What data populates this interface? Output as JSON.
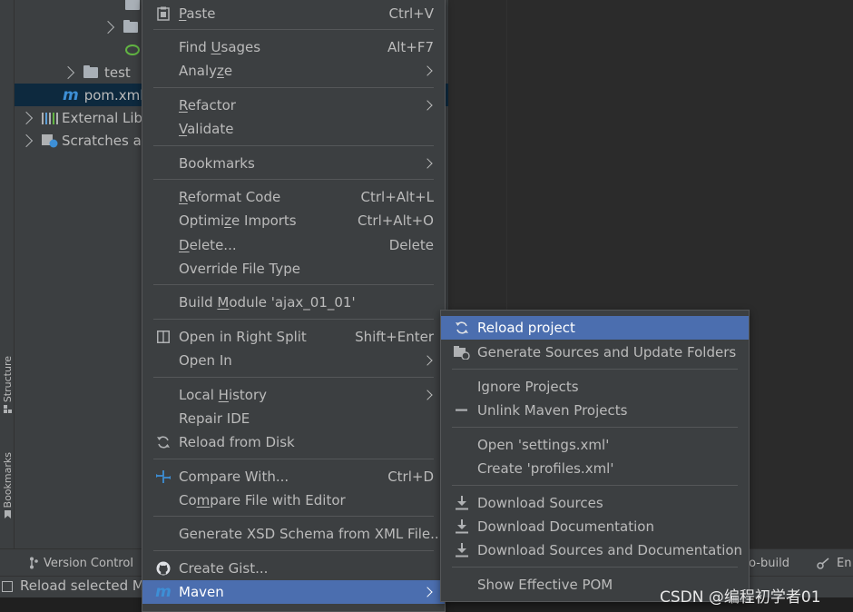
{
  "side_tabs": {
    "structure": "Structure",
    "bookmarks": "Bookmarks"
  },
  "project_tree": {
    "test_label": "test",
    "pom_label": "pom.xml",
    "external_libs_label": "External Lib",
    "scratches_label": "Scratches ar"
  },
  "bottom_tabs": {
    "version_control": "Version Control",
    "auto_build": "to-build",
    "endpoints": "En"
  },
  "status_bar": {
    "text": "Reload selected M"
  },
  "watermark": "CSDN @编程初学者01",
  "context_menu": {
    "paste": {
      "pre": "",
      "u": "P",
      "post": "aste",
      "shortcut": "Ctrl+V"
    },
    "find_usages": {
      "pre": "Find ",
      "u": "U",
      "post": "sages",
      "shortcut": "Alt+F7"
    },
    "analyze": {
      "pre": "Analy",
      "u": "z",
      "post": "e"
    },
    "refactor": {
      "pre": "",
      "u": "R",
      "post": "efactor"
    },
    "validate": {
      "pre": "",
      "u": "V",
      "post": "alidate"
    },
    "bookmarks": {
      "label": "Bookmarks"
    },
    "reformat_code": {
      "pre": "",
      "u": "R",
      "post": "eformat Code",
      "shortcut": "Ctrl+Alt+L"
    },
    "optimize_imports": {
      "pre": "Optimi",
      "u": "z",
      "post": "e Imports",
      "shortcut": "Ctrl+Alt+O"
    },
    "delete": {
      "pre": "",
      "u": "D",
      "post": "elete...",
      "shortcut": "Delete"
    },
    "override_file_type": {
      "label": "Override File Type"
    },
    "build_module": {
      "pre": "Build ",
      "u": "M",
      "post": "odule 'ajax_01_01'"
    },
    "open_right_split": {
      "label": "Open in Right Split",
      "shortcut": "Shift+Enter"
    },
    "open_in": {
      "label": "Open In"
    },
    "local_history": {
      "pre": "Local ",
      "u": "H",
      "post": "istory"
    },
    "repair_ide": {
      "label": "Repair IDE"
    },
    "reload_from_disk": {
      "label": "Reload from Disk"
    },
    "compare_with": {
      "label": "Compare With...",
      "shortcut": "Ctrl+D"
    },
    "compare_file_editor": {
      "pre": "Co",
      "u": "m",
      "post": "pare File with Editor"
    },
    "generate_xsd": {
      "label": "Generate XSD Schema from XML File..."
    },
    "create_gist": {
      "label": "Create Gist..."
    },
    "maven": {
      "label": "Maven"
    }
  },
  "maven_submenu": {
    "reload_project": "Reload project",
    "generate_sources": "Generate Sources and Update Folders",
    "ignore_projects": "Ignore Projects",
    "unlink_projects": "Unlink Maven Projects",
    "open_settings": "Open 'settings.xml'",
    "create_profiles": "Create 'profiles.xml'",
    "download_sources": "Download Sources",
    "download_docs": "Download Documentation",
    "download_both": "Download Sources and Documentation",
    "show_pom": "Show Effective POM"
  },
  "colors": {
    "menu_bg": "#3c3f41",
    "highlight": "#4b6eaf",
    "maven_icon": "#3d8fd6",
    "selection_row": "#0d293e"
  },
  "icons": [
    "paste-icon",
    "split-icon",
    "reload-icon",
    "compare-icon",
    "github-icon",
    "maven-icon",
    "download-icon",
    "folder-icon",
    "library-icon",
    "scratches-icon"
  ]
}
